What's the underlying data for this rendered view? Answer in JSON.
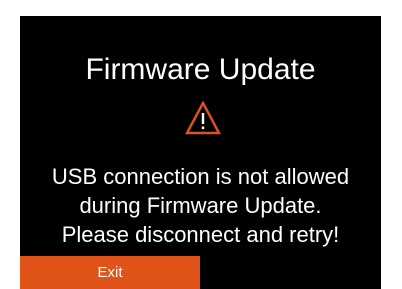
{
  "dialog": {
    "title": "Firmware Update",
    "icon": "warning-icon",
    "message_lines": [
      "USB connection is not allowed",
      "during Firmware Update.",
      "Please disconnect and retry!"
    ],
    "exit_label": "Exit"
  },
  "colors": {
    "background": "#000000",
    "text": "#ffffff",
    "accent": "#e0541a"
  }
}
